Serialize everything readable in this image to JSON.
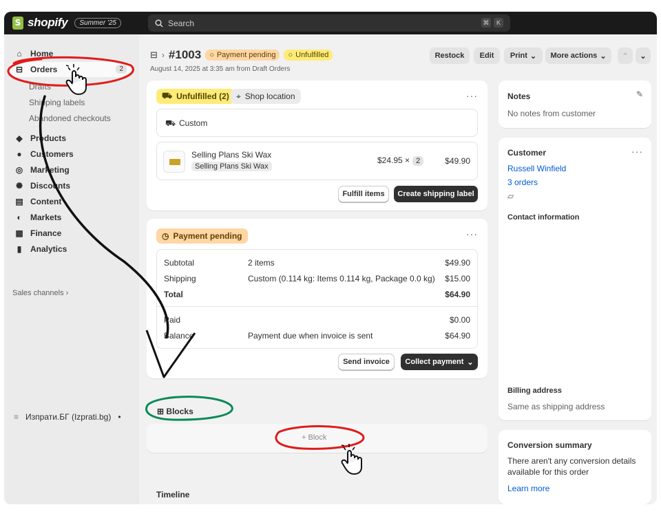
{
  "brand": {
    "name": "shopify",
    "edition": "Summer '25",
    "logo_letter": "S"
  },
  "search": {
    "placeholder": "Search",
    "shortcut_keys": [
      "⌘",
      "K"
    ]
  },
  "sidebar": {
    "items": [
      {
        "label": "Home",
        "icon": "home-icon"
      },
      {
        "label": "Orders",
        "icon": "inbox-icon",
        "badge": "2"
      },
      {
        "label": "Products",
        "icon": "tag-icon"
      },
      {
        "label": "Customers",
        "icon": "person-icon"
      },
      {
        "label": "Marketing",
        "icon": "target-icon"
      },
      {
        "label": "Discounts",
        "icon": "discount-icon"
      },
      {
        "label": "Content",
        "icon": "content-icon"
      },
      {
        "label": "Markets",
        "icon": "globe-icon"
      },
      {
        "label": "Finance",
        "icon": "bank-icon"
      },
      {
        "label": "Analytics",
        "icon": "chart-icon"
      }
    ],
    "order_subitems": [
      "Drafts",
      "Shipping labels",
      "Abandoned checkouts"
    ],
    "sales_channels": "Sales channels ›",
    "app": {
      "label": "Изпрати.БГ (Izprati.bg)",
      "dot": "•"
    }
  },
  "order": {
    "number": "#1003",
    "date": "August 14, 2025 at 3:35 am from Draft Orders",
    "badges": [
      "Payment pending",
      "Unfulfilled"
    ],
    "actions": {
      "restock": "Restock",
      "edit": "Edit",
      "print": "Print",
      "more": "More actions"
    }
  },
  "fulfillment": {
    "status": "Unfulfilled (2)",
    "location": "Shop location",
    "delivery": "Custom",
    "item": {
      "title": "Selling Plans Ski Wax",
      "variant": "Selling Plans Ski Wax",
      "price": "$24.95",
      "times": "×",
      "qty": "2",
      "total": "$49.90"
    },
    "fulfill_button": "Fulfill items",
    "label_button": "Create shipping label"
  },
  "payment": {
    "status": "Payment pending",
    "rows": [
      {
        "label": "Subtotal",
        "detail": "2 items",
        "amount": "$49.90"
      },
      {
        "label": "Shipping",
        "detail": "Custom (0.114 kg: Items 0.114 kg, Package 0.0 kg)",
        "amount": "$15.00"
      },
      {
        "label": "Total",
        "detail": "",
        "amount": "$64.90"
      }
    ],
    "paid": {
      "label": "Paid",
      "amount": "$0.00"
    },
    "balance": {
      "label": "Balance",
      "detail": "Payment due when invoice is sent",
      "amount": "$64.90"
    },
    "send_invoice": "Send invoice",
    "collect": "Collect payment"
  },
  "blocks": {
    "heading": "Blocks",
    "add": "+ Block"
  },
  "timeline": {
    "heading": "Timeline"
  },
  "notes": {
    "heading": "Notes",
    "empty": "No notes from customer"
  },
  "customer": {
    "heading": "Customer",
    "name": "Russell Winfield",
    "orders": "3 orders",
    "contact_heading": "Contact information",
    "billing_heading": "Billing address",
    "billing_value": "Same as shipping address"
  },
  "conversion": {
    "heading": "Conversion summary",
    "text_1": "There aren't any conversion details",
    "text_2": "available for this order",
    "link": "Learn more"
  },
  "colors": {
    "topbar": "#1a1a1a",
    "shopify_green": "#95bf47",
    "annotation_red": "#e01b1b",
    "annotation_green": "#0a8a55",
    "link_blue": "#005bd3"
  }
}
